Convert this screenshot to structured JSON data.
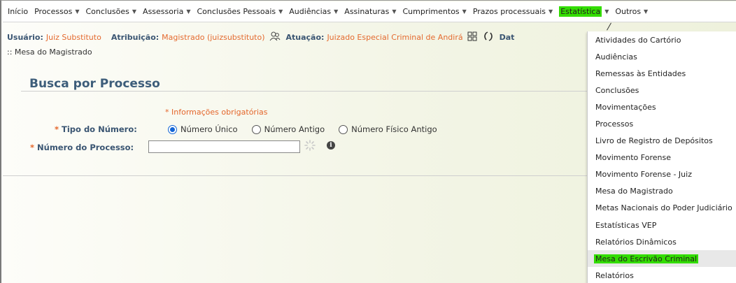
{
  "menubar": {
    "items": [
      {
        "label": "Início",
        "caret": false
      },
      {
        "label": "Processos",
        "caret": true
      },
      {
        "label": "Conclusões",
        "caret": true
      },
      {
        "label": "Assessoria",
        "caret": true
      },
      {
        "label": "Conclusões Pessoais",
        "caret": true
      },
      {
        "label": "Audiências",
        "caret": true
      },
      {
        "label": "Assinaturas",
        "caret": true
      },
      {
        "label": "Cumprimentos",
        "caret": true
      },
      {
        "label": "Prazos processuais",
        "caret": true
      },
      {
        "label": "Estatística",
        "caret": true,
        "active": true
      },
      {
        "label": "Outros",
        "caret": true
      }
    ],
    "caret_glyph": "▼"
  },
  "user_info": {
    "usuario_label": "Usuário:",
    "usuario_value": "Juiz Substituto",
    "atribuicao_label": "Atribuição:",
    "atribuicao_value": "Magistrado (juizsubstituto)",
    "atuacao_label": "Atuação:",
    "atuacao_value": "Juizado Especial Criminal de Andirá",
    "data_label_partial": "Dat",
    "icons": [
      "users-icon",
      "grid-icon",
      "refresh-icon"
    ]
  },
  "breadcrumb": ":: Mesa do Magistrado",
  "panel": {
    "title": "Busca por Processo",
    "required_note": "* Informações obrigatórias",
    "tipo_label": "Tipo do Número:",
    "numero_label": "Número do Processo:",
    "required_marker": "*",
    "radios": [
      {
        "label": "Número Único",
        "checked": true
      },
      {
        "label": "Número Antigo",
        "checked": false
      },
      {
        "label": "Número Físico Antigo",
        "checked": false
      }
    ],
    "numero_value": "",
    "info_glyph": "i"
  },
  "dropdown": {
    "items": [
      {
        "label": "Atividades do Cartório"
      },
      {
        "label": "Audiências"
      },
      {
        "label": "Remessas às Entidades"
      },
      {
        "label": "Conclusões"
      },
      {
        "label": "Movimentações"
      },
      {
        "label": "Processos"
      },
      {
        "label": "Livro de Registro de Depósitos"
      },
      {
        "label": "Movimento Forense"
      },
      {
        "label": "Movimento Forense - Juiz"
      },
      {
        "label": "Mesa do Magistrado"
      },
      {
        "label": "Metas Nacionais do Poder Judiciário"
      },
      {
        "label": "Estatísticas VEP"
      },
      {
        "label": "Relatórios Dinâmicos"
      },
      {
        "label": "Mesa do Escrivão Criminal",
        "hover": true
      },
      {
        "label": "Relatórios"
      }
    ]
  },
  "colors": {
    "highlight": "#33dd00",
    "label_blue": "#3a5572",
    "value_orange": "#e46a2f",
    "title_blue": "#3d5d7a"
  }
}
